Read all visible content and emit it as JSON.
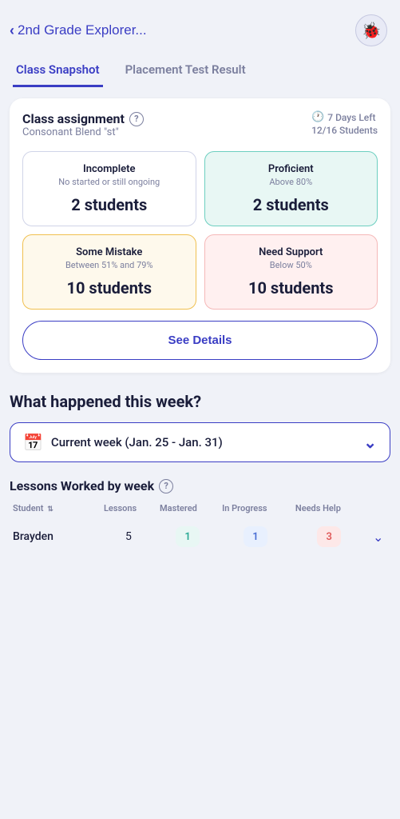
{
  "header": {
    "back_label": "2nd Grade Explorer...",
    "avatar_emoji": "🐞"
  },
  "tabs": [
    {
      "id": "class-snapshot",
      "label": "Class Snapshot",
      "active": true
    },
    {
      "id": "placement-test",
      "label": "Placement Test Result",
      "active": false
    }
  ],
  "assignment_card": {
    "title": "Class assignment",
    "subtitle": "Consonant Blend \"st\"",
    "days_left": "7 Days Left",
    "students": "12/16 Students",
    "stats": [
      {
        "id": "incomplete",
        "label": "Incomplete",
        "sublabel": "No started or still ongoing",
        "value": "2 students",
        "type": "incomplete"
      },
      {
        "id": "proficient",
        "label": "Proficient",
        "sublabel": "Above 80%",
        "value": "2 students",
        "type": "proficient"
      },
      {
        "id": "some-mistake",
        "label": "Some Mistake",
        "sublabel": "Between 51% and 79%",
        "value": "10 students",
        "type": "some-mistake"
      },
      {
        "id": "need-support",
        "label": "Need Support",
        "sublabel": "Below 50%",
        "value": "10 students",
        "type": "need-support"
      }
    ],
    "see_details_label": "See Details"
  },
  "weekly": {
    "section_title": "What happened this week?",
    "week_selector_label": "Current week (Jan. 25 - Jan. 31)",
    "lessons_title": "Lessons Worked by week",
    "table": {
      "headers": [
        {
          "label": "Student",
          "sortable": true
        },
        {
          "label": "Lessons",
          "sortable": false
        },
        {
          "label": "Mastered",
          "sortable": false
        },
        {
          "label": "In Progress",
          "sortable": false
        },
        {
          "label": "Needs Help",
          "sortable": false
        }
      ],
      "rows": [
        {
          "student": "Brayden",
          "lessons": "5",
          "mastered": "1",
          "in_progress": "1",
          "needs_help": "3"
        }
      ]
    }
  },
  "colors": {
    "primary": "#3a3dc4",
    "text_dark": "#1a1d3a",
    "text_muted": "#7b7f9e",
    "bg": "#f0f2f8"
  }
}
